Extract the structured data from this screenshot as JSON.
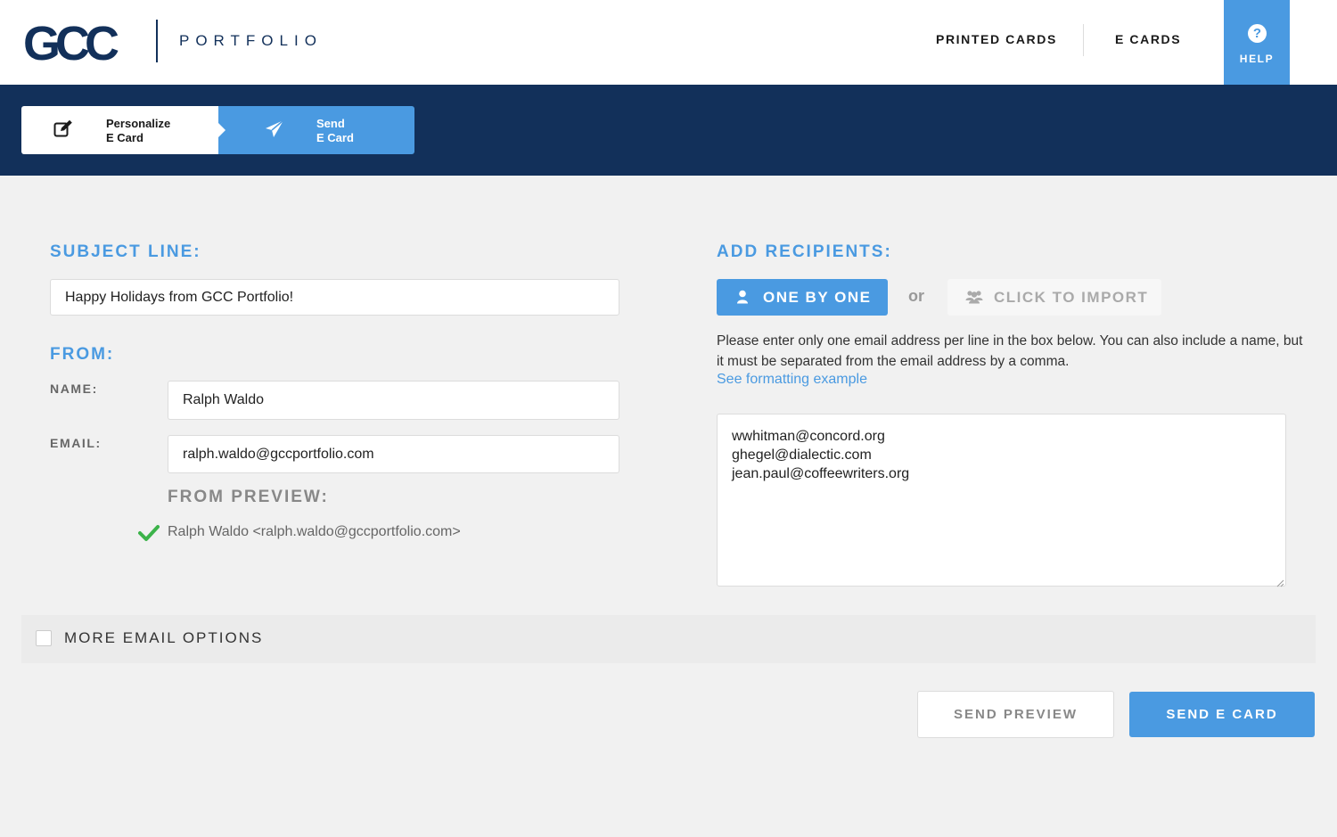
{
  "header": {
    "logo_text": "GCC",
    "portfolio_label": "PORTFOLIO",
    "nav": [
      {
        "label": "PRINTED CARDS"
      },
      {
        "label": "E CARDS"
      }
    ],
    "help_label": "HELP",
    "help_glyph": "?"
  },
  "steps": [
    {
      "line1": "Personalize",
      "line2": "E Card",
      "icon": "edit-icon",
      "active": false
    },
    {
      "line1": "Send",
      "line2": "E Card",
      "icon": "paper-plane-icon",
      "active": true
    }
  ],
  "subject": {
    "heading": "SUBJECT LINE:",
    "value": "Happy Holidays from GCC Portfolio!"
  },
  "from": {
    "heading": "FROM:",
    "name_label": "NAME:",
    "name_value": "Ralph Waldo",
    "email_label": "EMAIL:",
    "email_value": "ralph.waldo@gccportfolio.com",
    "preview_heading": "FROM PREVIEW:",
    "preview_text": "Ralph Waldo <ralph.waldo@gccportfolio.com>"
  },
  "recipients": {
    "heading": "ADD RECIPIENTS:",
    "one_by_one_label": "ONE BY ONE",
    "or_label": "or",
    "import_label": "CLICK TO IMPORT",
    "instructions": "Please enter only one email address per line in the box below. You can also include a name, but it must be separated from the email address by a comma.",
    "format_link": "See formatting example",
    "list": "wwhitman@concord.org\nghegel@dialectic.com\njean.paul@coffeewriters.org"
  },
  "more_options_label": "MORE EMAIL OPTIONS",
  "actions": {
    "preview_label": "SEND PREVIEW",
    "send_label": "SEND E CARD"
  },
  "colors": {
    "navy": "#12305a",
    "accent_blue": "#4a9ae1",
    "check_green": "#3cb34a"
  }
}
